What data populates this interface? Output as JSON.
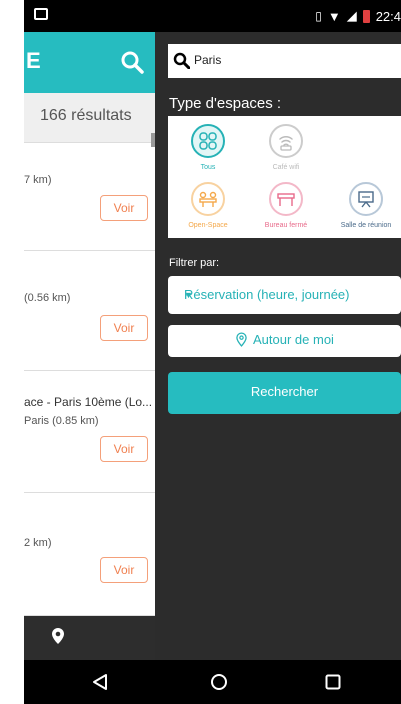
{
  "status_bar": {
    "time": "22:4"
  },
  "background_screen": {
    "logo_fragment": "E",
    "results_count": "166 résultats",
    "items": [
      {
        "title": "",
        "distance": "7 km)",
        "button": "Voir"
      },
      {
        "title": "",
        "distance": "(0.56 km)",
        "button": "Voir"
      },
      {
        "title": "ace - Paris 10ème (Lo...",
        "distance": "Paris (0.85 km)",
        "button": "Voir"
      },
      {
        "title": "",
        "distance": "2 km)",
        "button": "Voir"
      }
    ]
  },
  "filter_panel": {
    "search": {
      "value": "Paris"
    },
    "type_label": "Type d'espaces :",
    "types": [
      {
        "label": "Tous",
        "color": "#26b2b6",
        "selected": true
      },
      {
        "label": "Café wifi",
        "color": "#cccccc",
        "selected": false
      },
      {
        "label": "Open-Space",
        "color": "#f4a84a",
        "selected": false
      },
      {
        "label": "Bureau fermé",
        "color": "#e86a8a",
        "selected": false
      },
      {
        "label": "Salle de réunion",
        "color": "#4a6a8a",
        "selected": false
      }
    ],
    "filter_label": "Filtrer par:",
    "filter_value": "Réservation (heure, journée)",
    "around_label": "Autour de moi",
    "search_button": "Rechercher"
  },
  "colors": {
    "accent": "#26bcc0",
    "panel": "#2c2c2c",
    "voir": "#f08050"
  }
}
